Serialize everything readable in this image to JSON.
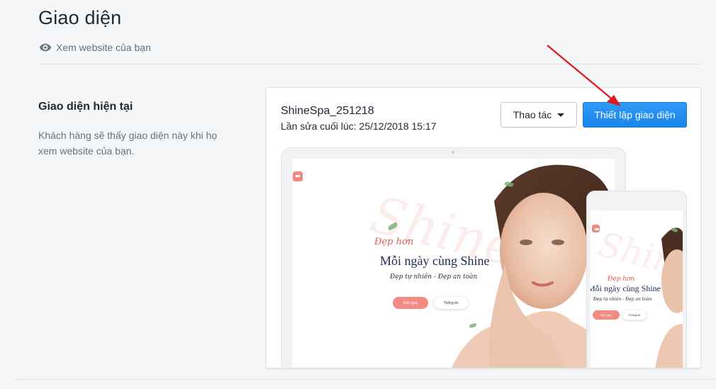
{
  "header": {
    "title": "Giao diện",
    "view_link": "Xem website của bạn"
  },
  "section": {
    "heading": "Giao diện hiện tại",
    "description": "Khách hàng sẽ thấy giao diện này khi họ xem website của bạn."
  },
  "theme": {
    "name": "ShineSpa_251218",
    "last_edited": "Lần sửa cuối lúc: 25/12/2018 15:17",
    "actions_button": "Thao tác",
    "customize_button": "Thiết lập giao diện"
  },
  "preview": {
    "script_text": "Shine",
    "kicker": "Đẹp hơn",
    "headline": "Mỗi ngày cùng Shine",
    "tagline": "Đẹp tự nhiên - Đẹp an toàn",
    "cta_primary": "Gửi ngay",
    "cta_secondary": "Thông tin"
  },
  "colors": {
    "primary_button": "#1a85ea",
    "annotation_arrow": "#e3161b",
    "accent": "#f28b82"
  },
  "icons": {
    "view": "eye-icon",
    "dropdown": "caret-down-icon"
  }
}
